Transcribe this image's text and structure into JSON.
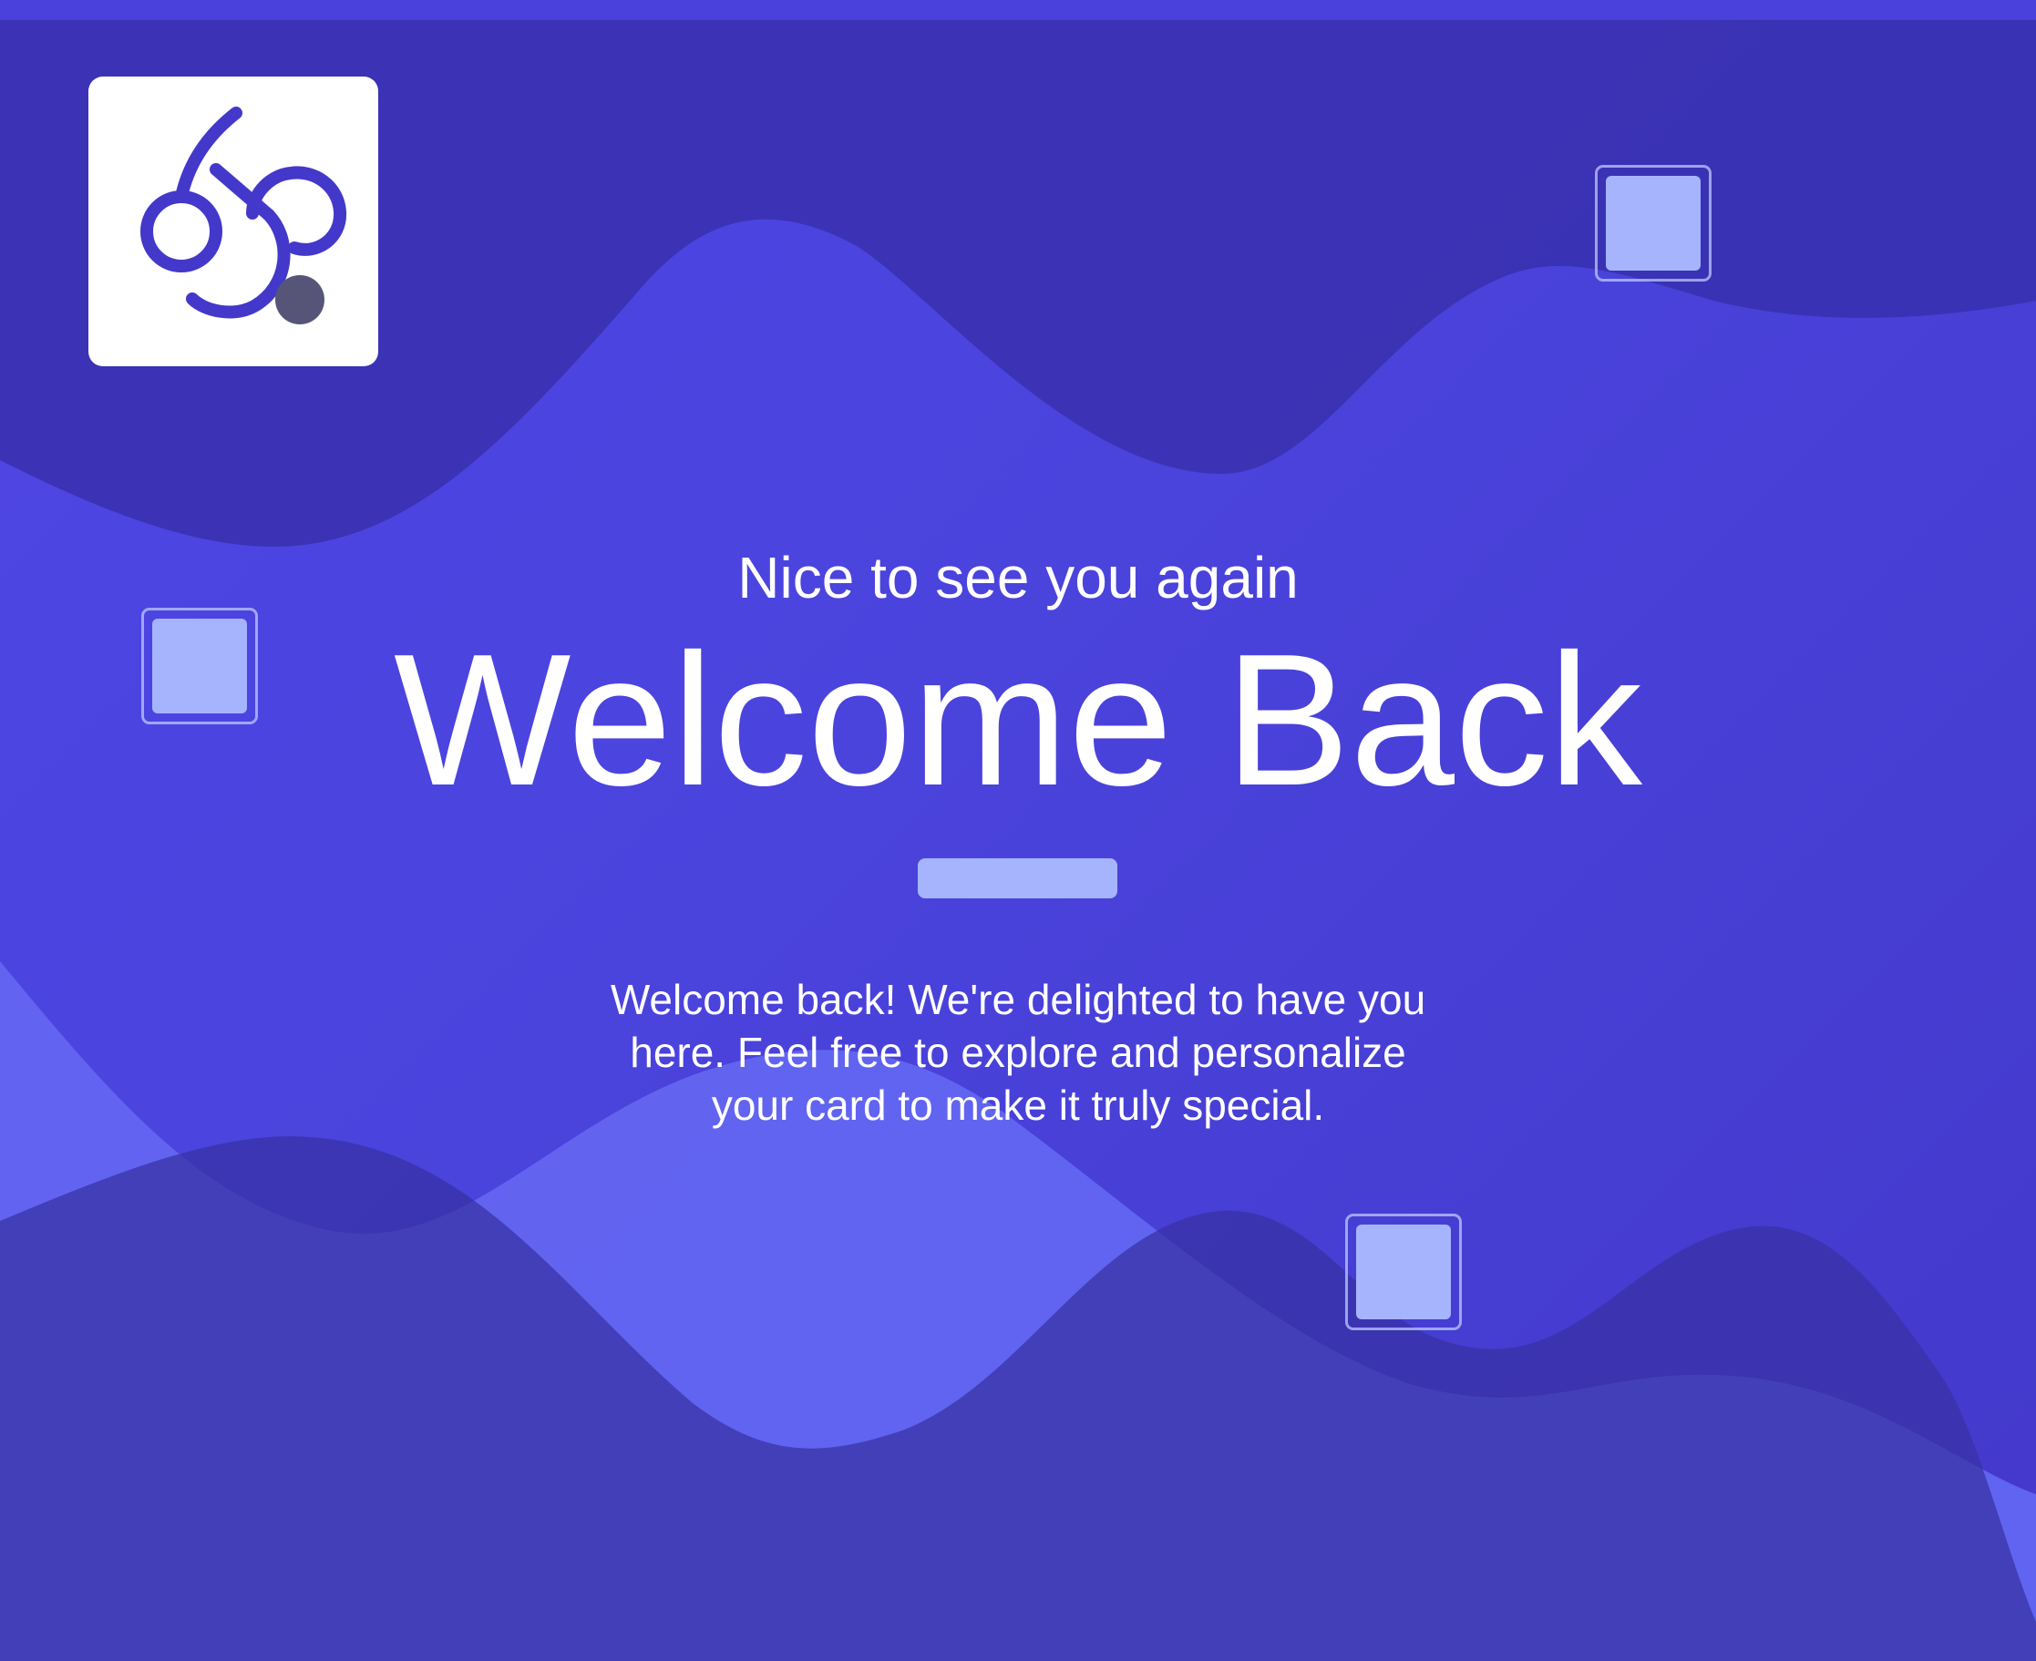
{
  "logo": {
    "icon": "abstract-swirl-logo-icon",
    "background": "#ffffff",
    "stroke_color": "#4338ca",
    "dot_color": "#575577"
  },
  "greeting": {
    "subtitle": "Nice to see you again",
    "title": "Welcome Back",
    "message": "Welcome back! We're delighted to have you here. Feel free to explore and personalize your card to make it truly special."
  },
  "colors": {
    "background": "#4f46e5",
    "wave_dark": "#3730a3",
    "wave_light": "#6366f1",
    "accent": "#a5b4fc",
    "text": "#ffffff"
  },
  "decorations": [
    "square-decoration",
    "square-decoration",
    "square-decoration"
  ]
}
